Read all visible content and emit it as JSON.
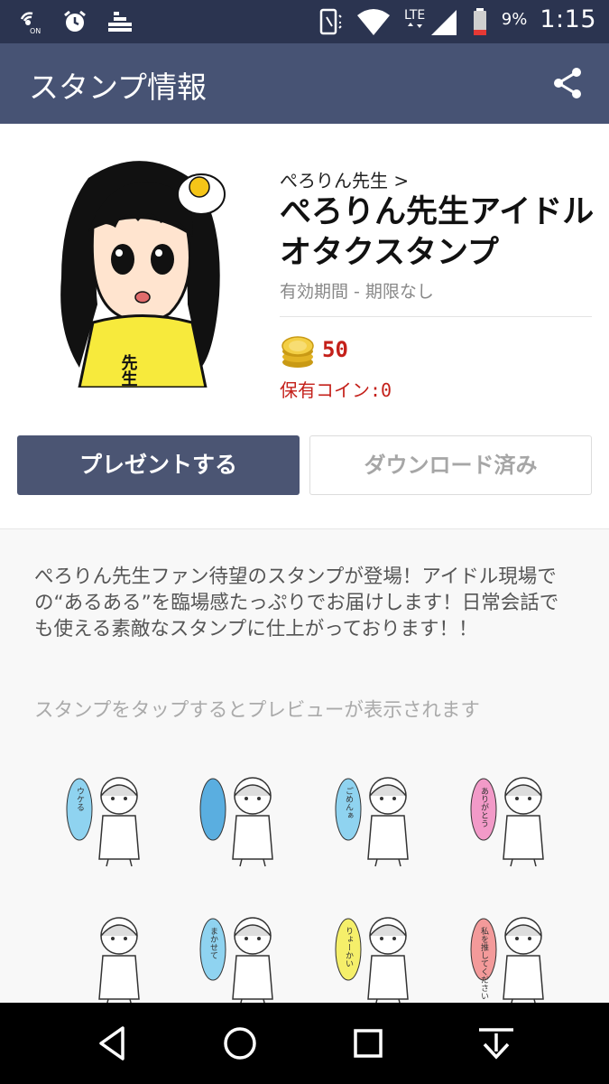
{
  "status_bar": {
    "left_icons": [
      "nfc-on-icon",
      "alarm-icon",
      "equalizer-icon"
    ],
    "right_icons": [
      "vibrate-icon",
      "wifi-icon",
      "lte-signal-icon",
      "battery-icon"
    ],
    "nfc_label": "ON",
    "network_label": "LTE",
    "battery_percent": "9%",
    "time": "1:15"
  },
  "app_bar": {
    "title": "スタンプ情報",
    "share_icon": "share-icon"
  },
  "sticker": {
    "author": "ぺろりん先生 >",
    "title": "ぺろりん先生アイドルオタクスタンプ",
    "validity": "有効期間 - 期限なし",
    "price": "50",
    "owned_coins": "保有コイン:0",
    "shirt_text": "先生"
  },
  "buttons": {
    "present": "プレゼントする",
    "downloaded": "ダウンロード済み"
  },
  "description": "ぺろりん先生ファン待望のスタンプが登場！アイドル現場での“あるある”を臨場感たっぷりでお届けします！日常会話でも使える素敵なスタンプに仕上がっております！！",
  "preview_hint": "スタンプをタップするとプレビューが表示されます",
  "preview_stickers": [
    {
      "bubble_text": "ウケる",
      "bubble_color": "#8fd3f0"
    },
    {
      "bubble_text": "",
      "bubble_color": "#5aaee0"
    },
    {
      "bubble_text": "ごめんぁ",
      "bubble_color": "#8fd3f0"
    },
    {
      "bubble_text": "ありがとう",
      "bubble_color": "#f29ac8"
    },
    {
      "bubble_text": "",
      "bubble_color": ""
    },
    {
      "bubble_text": "まかせて",
      "bubble_color": "#8fd3f0"
    },
    {
      "bubble_text": "りょーかい",
      "bubble_color": "#f5ef6a"
    },
    {
      "bubble_text": "私を推してください",
      "bubble_color": "#f39a9a"
    }
  ],
  "nav_bar": {
    "icons": [
      "back-icon",
      "home-icon",
      "recents-icon",
      "download-icon"
    ]
  },
  "colors": {
    "status_bar": "#2b3450",
    "app_bar": "#475374",
    "present_button": "#4b5573",
    "price_red": "#c4201a"
  }
}
